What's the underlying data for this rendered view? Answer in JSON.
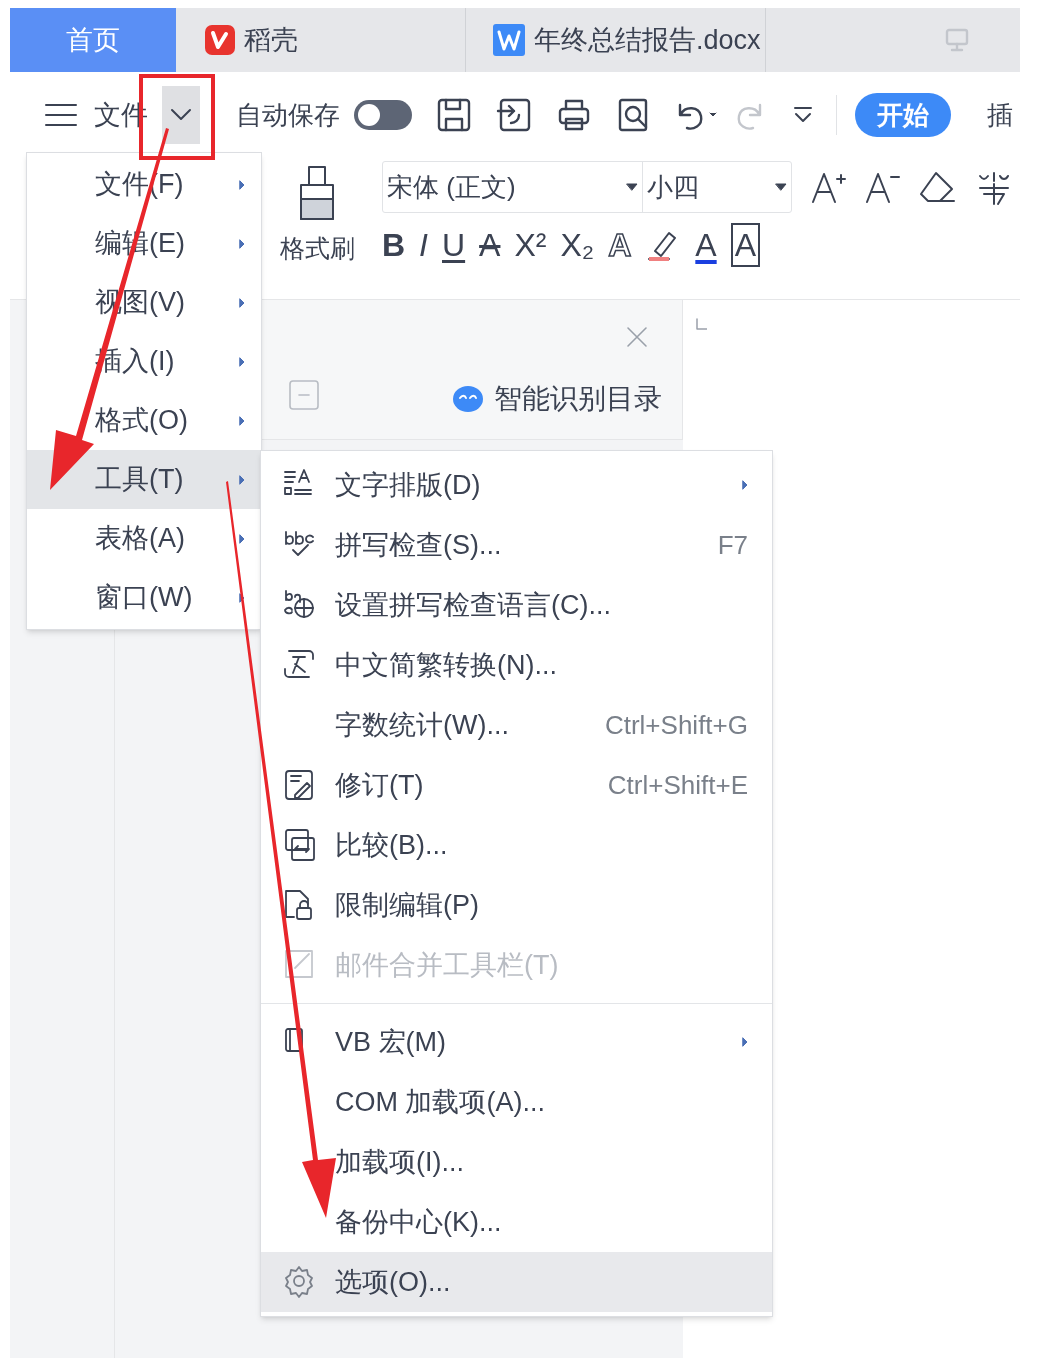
{
  "tabs": [
    {
      "label": "首页",
      "selected": true,
      "kind": "home"
    },
    {
      "label": "稻壳",
      "selected": false,
      "kind": "docer"
    },
    {
      "label": "年终总结报告.docx",
      "selected": false,
      "kind": "doc"
    }
  ],
  "toolbar": {
    "file_label": "文件",
    "autosave_label": "自动保存",
    "autosave_on": false,
    "start_label": "开始",
    "next_tab": "插"
  },
  "ribbon": {
    "format_painter": "格式刷",
    "font": "宋体 (正文)",
    "size": "小四",
    "format_buttons": [
      {
        "label": "B",
        "kind": "bold"
      },
      {
        "label": "I",
        "kind": "italic"
      },
      {
        "label": "U",
        "kind": "underline"
      },
      {
        "label": "A",
        "kind": "strike"
      },
      {
        "label": "X²",
        "kind": "plain"
      },
      {
        "label": "X₂",
        "kind": "plain"
      },
      {
        "label": "A",
        "kind": "outline"
      },
      {
        "label": "A",
        "kind": "color"
      },
      {
        "label": "A",
        "kind": "boxed"
      }
    ]
  },
  "nav_pane": {
    "action": "智能识别目录"
  },
  "menu": [
    {
      "label": "文件(F)",
      "selected": false
    },
    {
      "label": "编辑(E)",
      "selected": false
    },
    {
      "label": "视图(V)",
      "selected": false
    },
    {
      "label": "插入(I)",
      "selected": false
    },
    {
      "label": "格式(O)",
      "selected": false
    },
    {
      "label": "工具(T)",
      "selected": true
    },
    {
      "label": "表格(A)",
      "selected": false
    },
    {
      "label": "窗口(W)",
      "selected": false
    }
  ],
  "submenu": [
    {
      "label": "文字排版(D)",
      "kind": "layout",
      "submenu": true,
      "disabled": false,
      "selected": false
    },
    {
      "label": "拼写检查(S)...",
      "kind": "spell",
      "shortcut": "F7",
      "disabled": false,
      "selected": false
    },
    {
      "label": "设置拼写检查语言(C)...",
      "kind": "lang",
      "disabled": false,
      "selected": false
    },
    {
      "label": "中文简繁转换(N)...",
      "kind": "convert",
      "disabled": false,
      "selected": false
    },
    {
      "label": "字数统计(W)...",
      "shortcut": "Ctrl+Shift+G",
      "disabled": false,
      "selected": false
    },
    {
      "label": "修订(T)",
      "kind": "revise",
      "shortcut": "Ctrl+Shift+E",
      "disabled": false,
      "selected": false
    },
    {
      "label": "比较(B)...",
      "kind": "compare",
      "disabled": false,
      "selected": false
    },
    {
      "label": "限制编辑(P)",
      "kind": "lock",
      "disabled": false,
      "selected": false
    },
    {
      "label": "邮件合并工具栏(T)",
      "kind": "mail",
      "disabled": true,
      "selected": false
    },
    {
      "label": "VB 宏(M)",
      "kind": "macro",
      "submenu": true,
      "separator_before": true,
      "disabled": false,
      "selected": false
    },
    {
      "label": "COM 加载项(A)...",
      "disabled": false,
      "selected": false
    },
    {
      "label": "加载项(I)...",
      "disabled": false,
      "selected": false
    },
    {
      "label": "备份中心(K)...",
      "disabled": false,
      "selected": false
    },
    {
      "label": "选项(O)...",
      "kind": "gear",
      "disabled": false,
      "selected": true
    }
  ]
}
